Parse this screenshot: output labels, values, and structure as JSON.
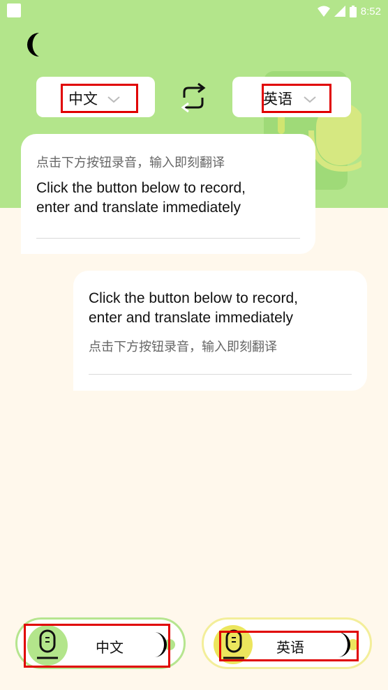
{
  "status_bar": {
    "time": "8:52"
  },
  "languages": {
    "source": "中文",
    "target": "英语"
  },
  "messages": [
    {
      "source_text": "点击下方按钮录音，输入即刻翻译",
      "translation_line1": "Click the button below to record,",
      "translation_line2": "enter and translate immediately"
    },
    {
      "translation_line1": "Click the button below to record,",
      "translation_line2": "enter and translate immediately",
      "source_text": "点击下方按钮录音，输入即刻翻译"
    }
  ],
  "record_buttons": {
    "left_label": "中文",
    "right_label": "英语"
  },
  "colors": {
    "header_green": "#b3e58b",
    "page_bg": "#fff8ec",
    "highlight_red": "#e00000",
    "mic_yellow": "#e9e55a"
  }
}
